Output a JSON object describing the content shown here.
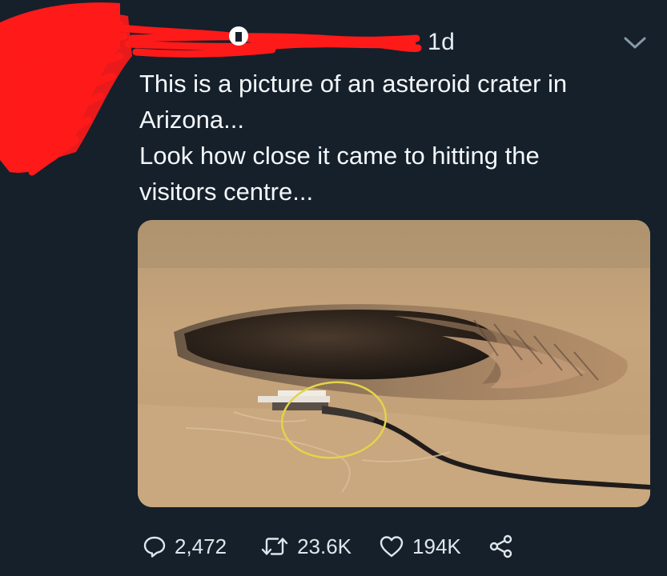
{
  "tweet": {
    "time": "1d",
    "lines": [
      "This is a picture of an asteroid crater in",
      "Arizona...",
      "Look how close it came to hitting the",
      "visitors centre..."
    ]
  },
  "media": {
    "description_icon": "crater-photo",
    "highlight_color": "#e2d44a"
  },
  "actions": {
    "replies": "2,472",
    "retweets": "23.6K",
    "likes": "194K"
  },
  "colors": {
    "background": "#15202b",
    "redaction": "#ff1a1a"
  }
}
